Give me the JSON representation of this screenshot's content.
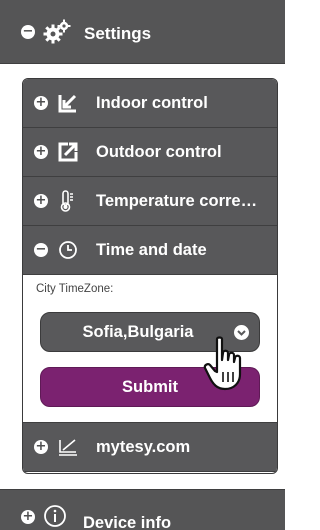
{
  "header": {
    "title": "Settings",
    "sign": "−",
    "icon": "gears-icon"
  },
  "menu": [
    {
      "label": "Indoor control",
      "sign": "+",
      "icon": "arrow-in-icon"
    },
    {
      "label": "Outdoor control",
      "sign": "+",
      "icon": "arrow-out-icon"
    },
    {
      "label": "Temperature correction",
      "sign": "+",
      "icon": "thermometer-icon"
    },
    {
      "label": "Time and date",
      "sign": "−",
      "icon": "clock-icon"
    }
  ],
  "time_and_date": {
    "timezone_label": "City TimeZone:",
    "timezone_value": "Sofia,Bulgaria",
    "submit_label": "Submit"
  },
  "menu_after": {
    "label": "mytesy.com",
    "sign": "+",
    "icon": "monitor-icon"
  },
  "footer": {
    "label": "Device info",
    "sign": "+",
    "icon": "info-icon"
  }
}
